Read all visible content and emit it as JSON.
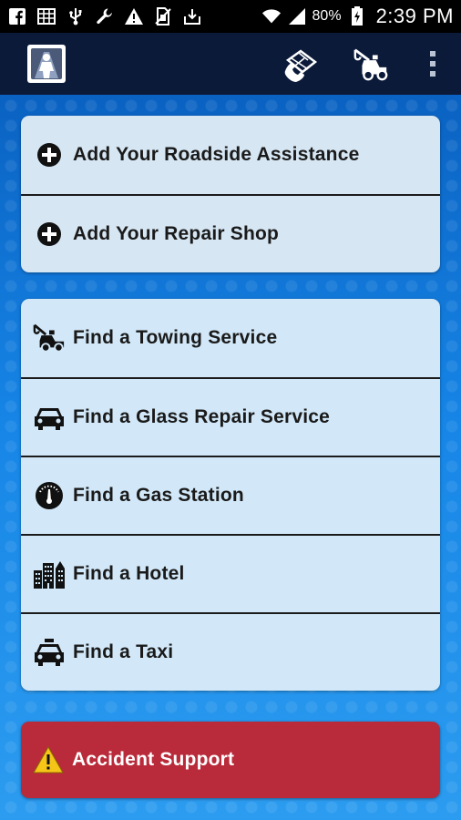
{
  "status_bar": {
    "battery_percent": "80%",
    "time": "2:39 PM",
    "left_icons": [
      "facebook-icon",
      "calendar-icon",
      "usb-icon",
      "wrench-icon",
      "warning-icon",
      "sim-off-icon",
      "download-icon"
    ],
    "right_icons": [
      "wifi-icon",
      "signal-icon",
      "battery-charging-icon"
    ]
  },
  "app_bar": {
    "logo": "app-logo-icon",
    "actions": [
      "phone-map-icon",
      "tow-truck-icon",
      "overflow-menu-icon"
    ]
  },
  "my_services": [
    {
      "icon": "plus-circle-icon",
      "label": "Add Your Roadside Assistance"
    },
    {
      "icon": "plus-circle-icon",
      "label": "Add Your Repair Shop"
    }
  ],
  "find_services": [
    {
      "icon": "tow-truck-icon",
      "label": "Find a Towing Service"
    },
    {
      "icon": "car-icon",
      "label": "Find a Glass Repair Service"
    },
    {
      "icon": "fuel-gauge-icon",
      "label": "Find a Gas Station"
    },
    {
      "icon": "hotel-icon",
      "label": "Find a Hotel"
    },
    {
      "icon": "taxi-icon",
      "label": "Find a Taxi"
    }
  ],
  "accident_support": {
    "icon": "warning-triangle-icon",
    "label": "Accident Support"
  },
  "colors": {
    "status_bar": "#000000",
    "app_bar": "#0c1a3a",
    "background_top": "#0a62c2",
    "background_bottom": "#2c9cf0",
    "card": "#d6e6f3",
    "accident": "#b92a3a",
    "warning_yellow": "#f5c518"
  }
}
